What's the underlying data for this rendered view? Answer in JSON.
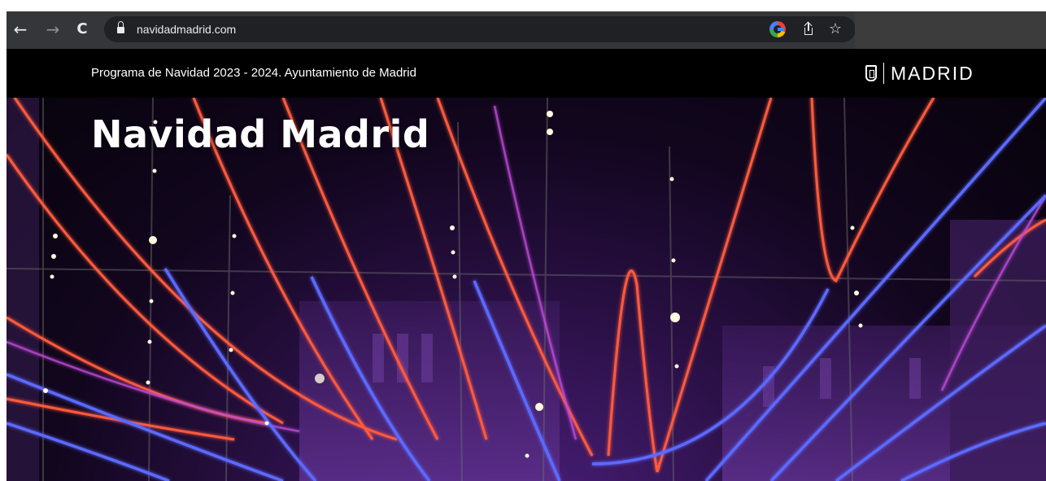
{
  "browser": {
    "url": "navidadmadrid.com",
    "icons": {
      "back": "arrow-left-icon",
      "forward": "arrow-right-icon",
      "reload": "reload-icon",
      "lock": "lock-icon",
      "google": "google-icon",
      "share": "share-icon",
      "bookmark": "star-icon"
    }
  },
  "header": {
    "subtitle": "Programa de Navidad 2023 - 2024. Ayuntamiento de Madrid",
    "logo_text": "MADRID"
  },
  "hero": {
    "title": "Navidad Madrid"
  },
  "colors": {
    "chrome": "#35363a",
    "omnibox": "#202124",
    "header_bg": "#000000",
    "light_red": "#ff5a3c",
    "light_blue": "#5b6bff",
    "light_magenta": "#c04cd8"
  }
}
